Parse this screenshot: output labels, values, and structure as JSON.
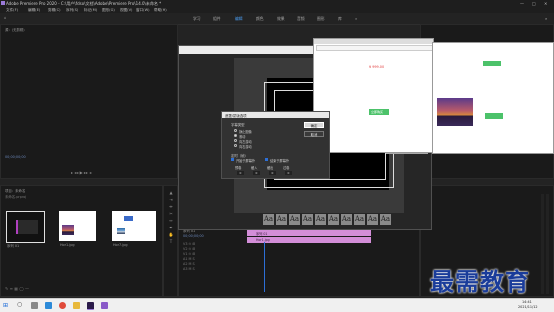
{
  "app": {
    "title": "Adobe Premiere Pro 2020 - C:\\用户\\fdso\\文档\\Adobe\\Premiere Pro\\14.0\\未命名 *",
    "window_controls": [
      "—",
      "□",
      "✕"
    ]
  },
  "menu": [
    "文件(F)",
    "编辑(E)",
    "剪辑(C)",
    "序列(S)",
    "标记(M)",
    "图形(G)",
    "视图(V)",
    "窗口(W)",
    "帮助(H)"
  ],
  "workspaces": {
    "items": [
      "学习",
      "组件",
      "编辑",
      "颜色",
      "效果",
      "音频",
      "图形",
      "库"
    ],
    "active": 2
  },
  "source_panel": {
    "tab": "源：(无剪辑)",
    "timecode": "00;00;00;00"
  },
  "project_panel": {
    "tab": "项目：未命名",
    "file": "未命名.prproj",
    "clips": [
      {
        "name": "序列 01"
      },
      {
        "name": "Hor1.jpg"
      },
      {
        "name": "Hor7.jpg"
      },
      {
        "name": "Hor6.jpg"
      }
    ]
  },
  "timeline": {
    "tab": "序列 01",
    "timecode": "00;00;00;00",
    "clips": [
      {
        "track": "V2",
        "name": "序列 01",
        "color": "#d38ed8"
      },
      {
        "track": "V1",
        "name": "Hor1.jpg",
        "color": "#d38ed8"
      }
    ]
  },
  "title_styles": [
    "Aa",
    "Aa",
    "Aa",
    "Aa",
    "Aa",
    "Aa",
    "Aa",
    "Aa",
    "Aa",
    "Aa"
  ],
  "dialog": {
    "title": "遮罩/蒙版选项",
    "section_label": "字幕类型",
    "options": [
      "静止图像",
      "滚动",
      "向左游动",
      "向右游动"
    ],
    "selected_option": 1,
    "timing_label": "定时（帧）",
    "checkbox_start": "开始于屏幕外",
    "checkbox_end": "结束于屏幕外",
    "fields": [
      "预卷",
      "缓入",
      "缓出",
      "过卷"
    ],
    "field_values": [
      "0",
      "0",
      "0",
      "0"
    ],
    "ok": "确定",
    "cancel": "取消"
  },
  "browser": {
    "url": "",
    "price": "¥ 999.00",
    "button": "立即购买"
  },
  "taskbar": {
    "time": "14:41",
    "date": "2021/11/12"
  },
  "watermark": "最需教育"
}
